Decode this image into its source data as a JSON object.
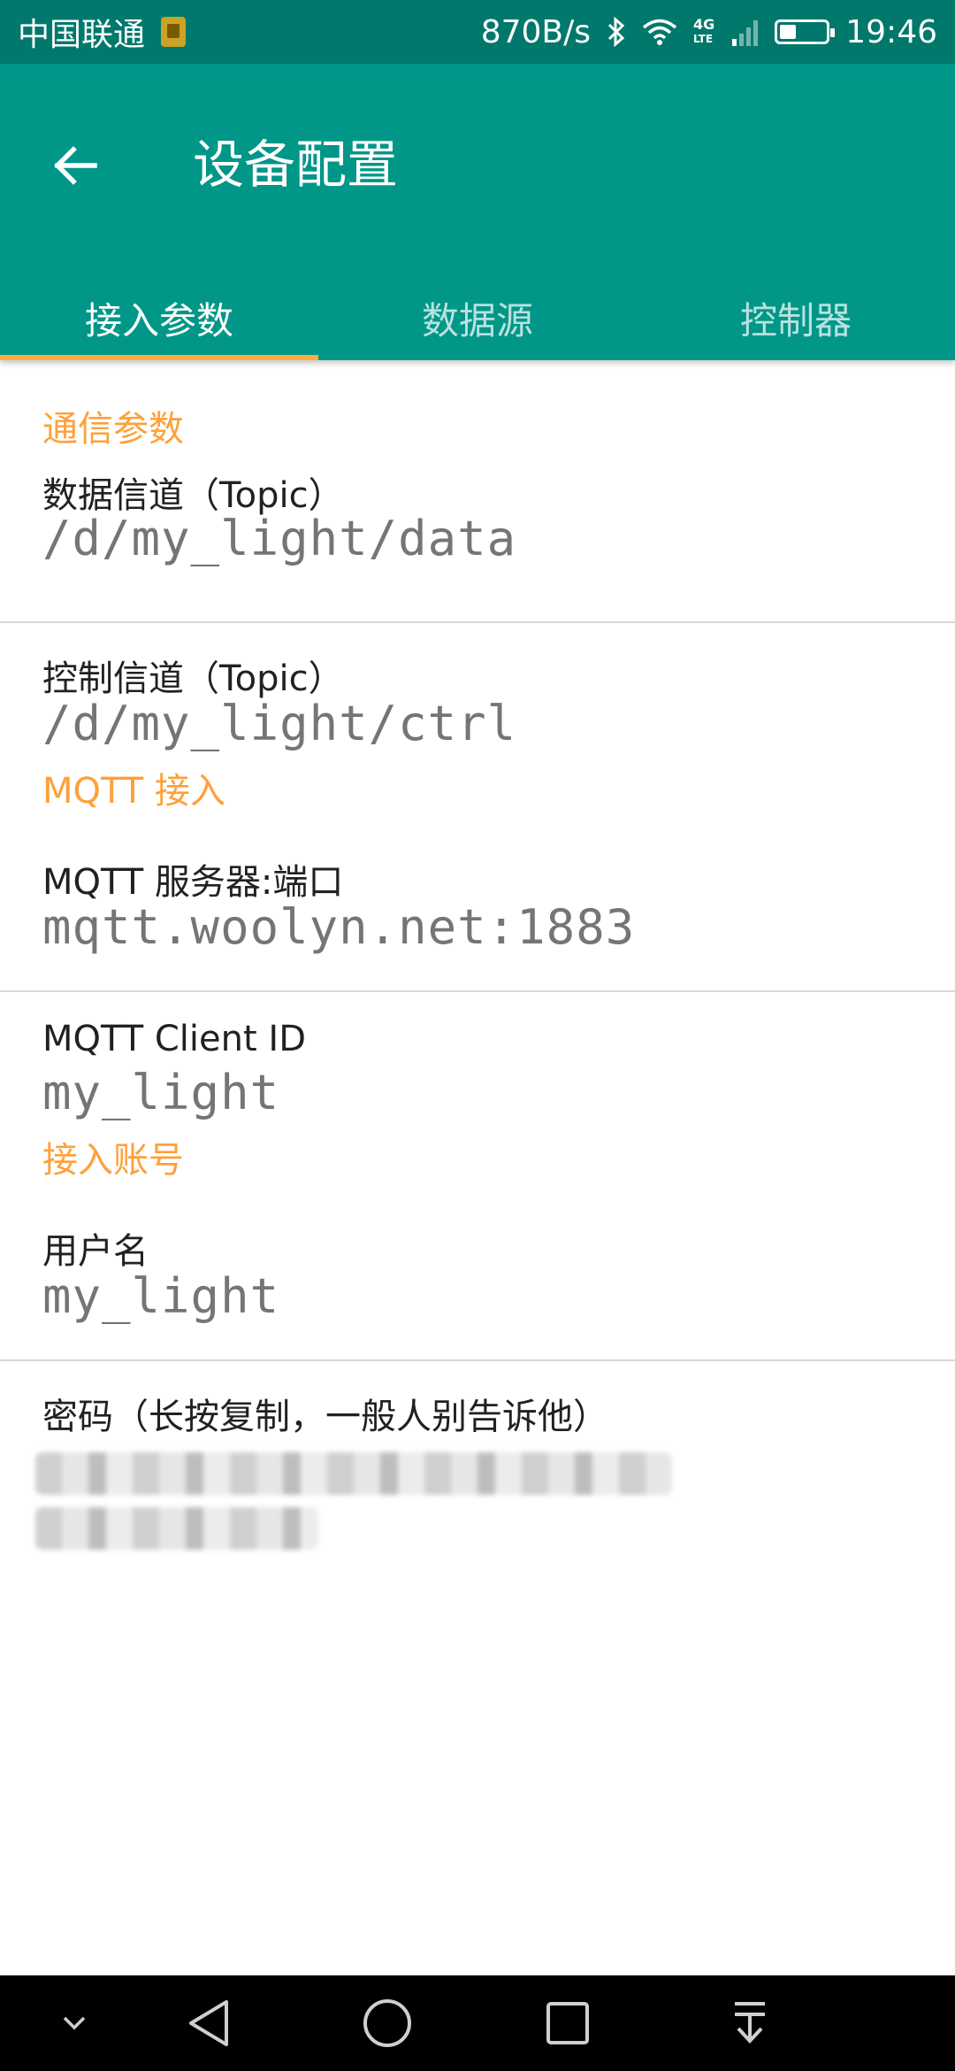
{
  "status_bar": {
    "carrier": "中国联通",
    "net_speed": "870B/s",
    "network_type": "4G",
    "network_sub": "LTE",
    "time": "19:46",
    "battery_percent": 35
  },
  "app_bar": {
    "back_icon": "arrow-left-icon",
    "title": "设备配置"
  },
  "tabs": [
    {
      "label": "接入参数",
      "active": true
    },
    {
      "label": "数据源",
      "active": false
    },
    {
      "label": "控制器",
      "active": false
    }
  ],
  "sections": {
    "comm": {
      "header": "通信参数",
      "data_topic_label": "数据信道（Topic）",
      "data_topic_value": "/d/my_light/data",
      "ctrl_topic_label": "控制信道（Topic）",
      "ctrl_topic_value": "/d/my_light/ctrl"
    },
    "mqtt": {
      "header": "MQTT 接入",
      "server_label": "MQTT 服务器:端口",
      "server_value": "mqtt.woolyn.net:1883",
      "client_id_label": "MQTT Client ID",
      "client_id_value": "my_light"
    },
    "account": {
      "header": "接入账号",
      "username_label": "用户名",
      "username_value": "my_light",
      "password_label": "密码（长按复制，一般人别告诉他）"
    }
  },
  "nav_bar": {
    "icons": [
      "chevron-down-icon",
      "back-triangle-icon",
      "home-circle-icon",
      "recents-square-icon",
      "notification-pull-icon"
    ]
  },
  "colors": {
    "status_bar": "#00786c",
    "app_bar": "#009688",
    "tab_indicator": "#ffab40",
    "section_header": "#ffa03a"
  }
}
